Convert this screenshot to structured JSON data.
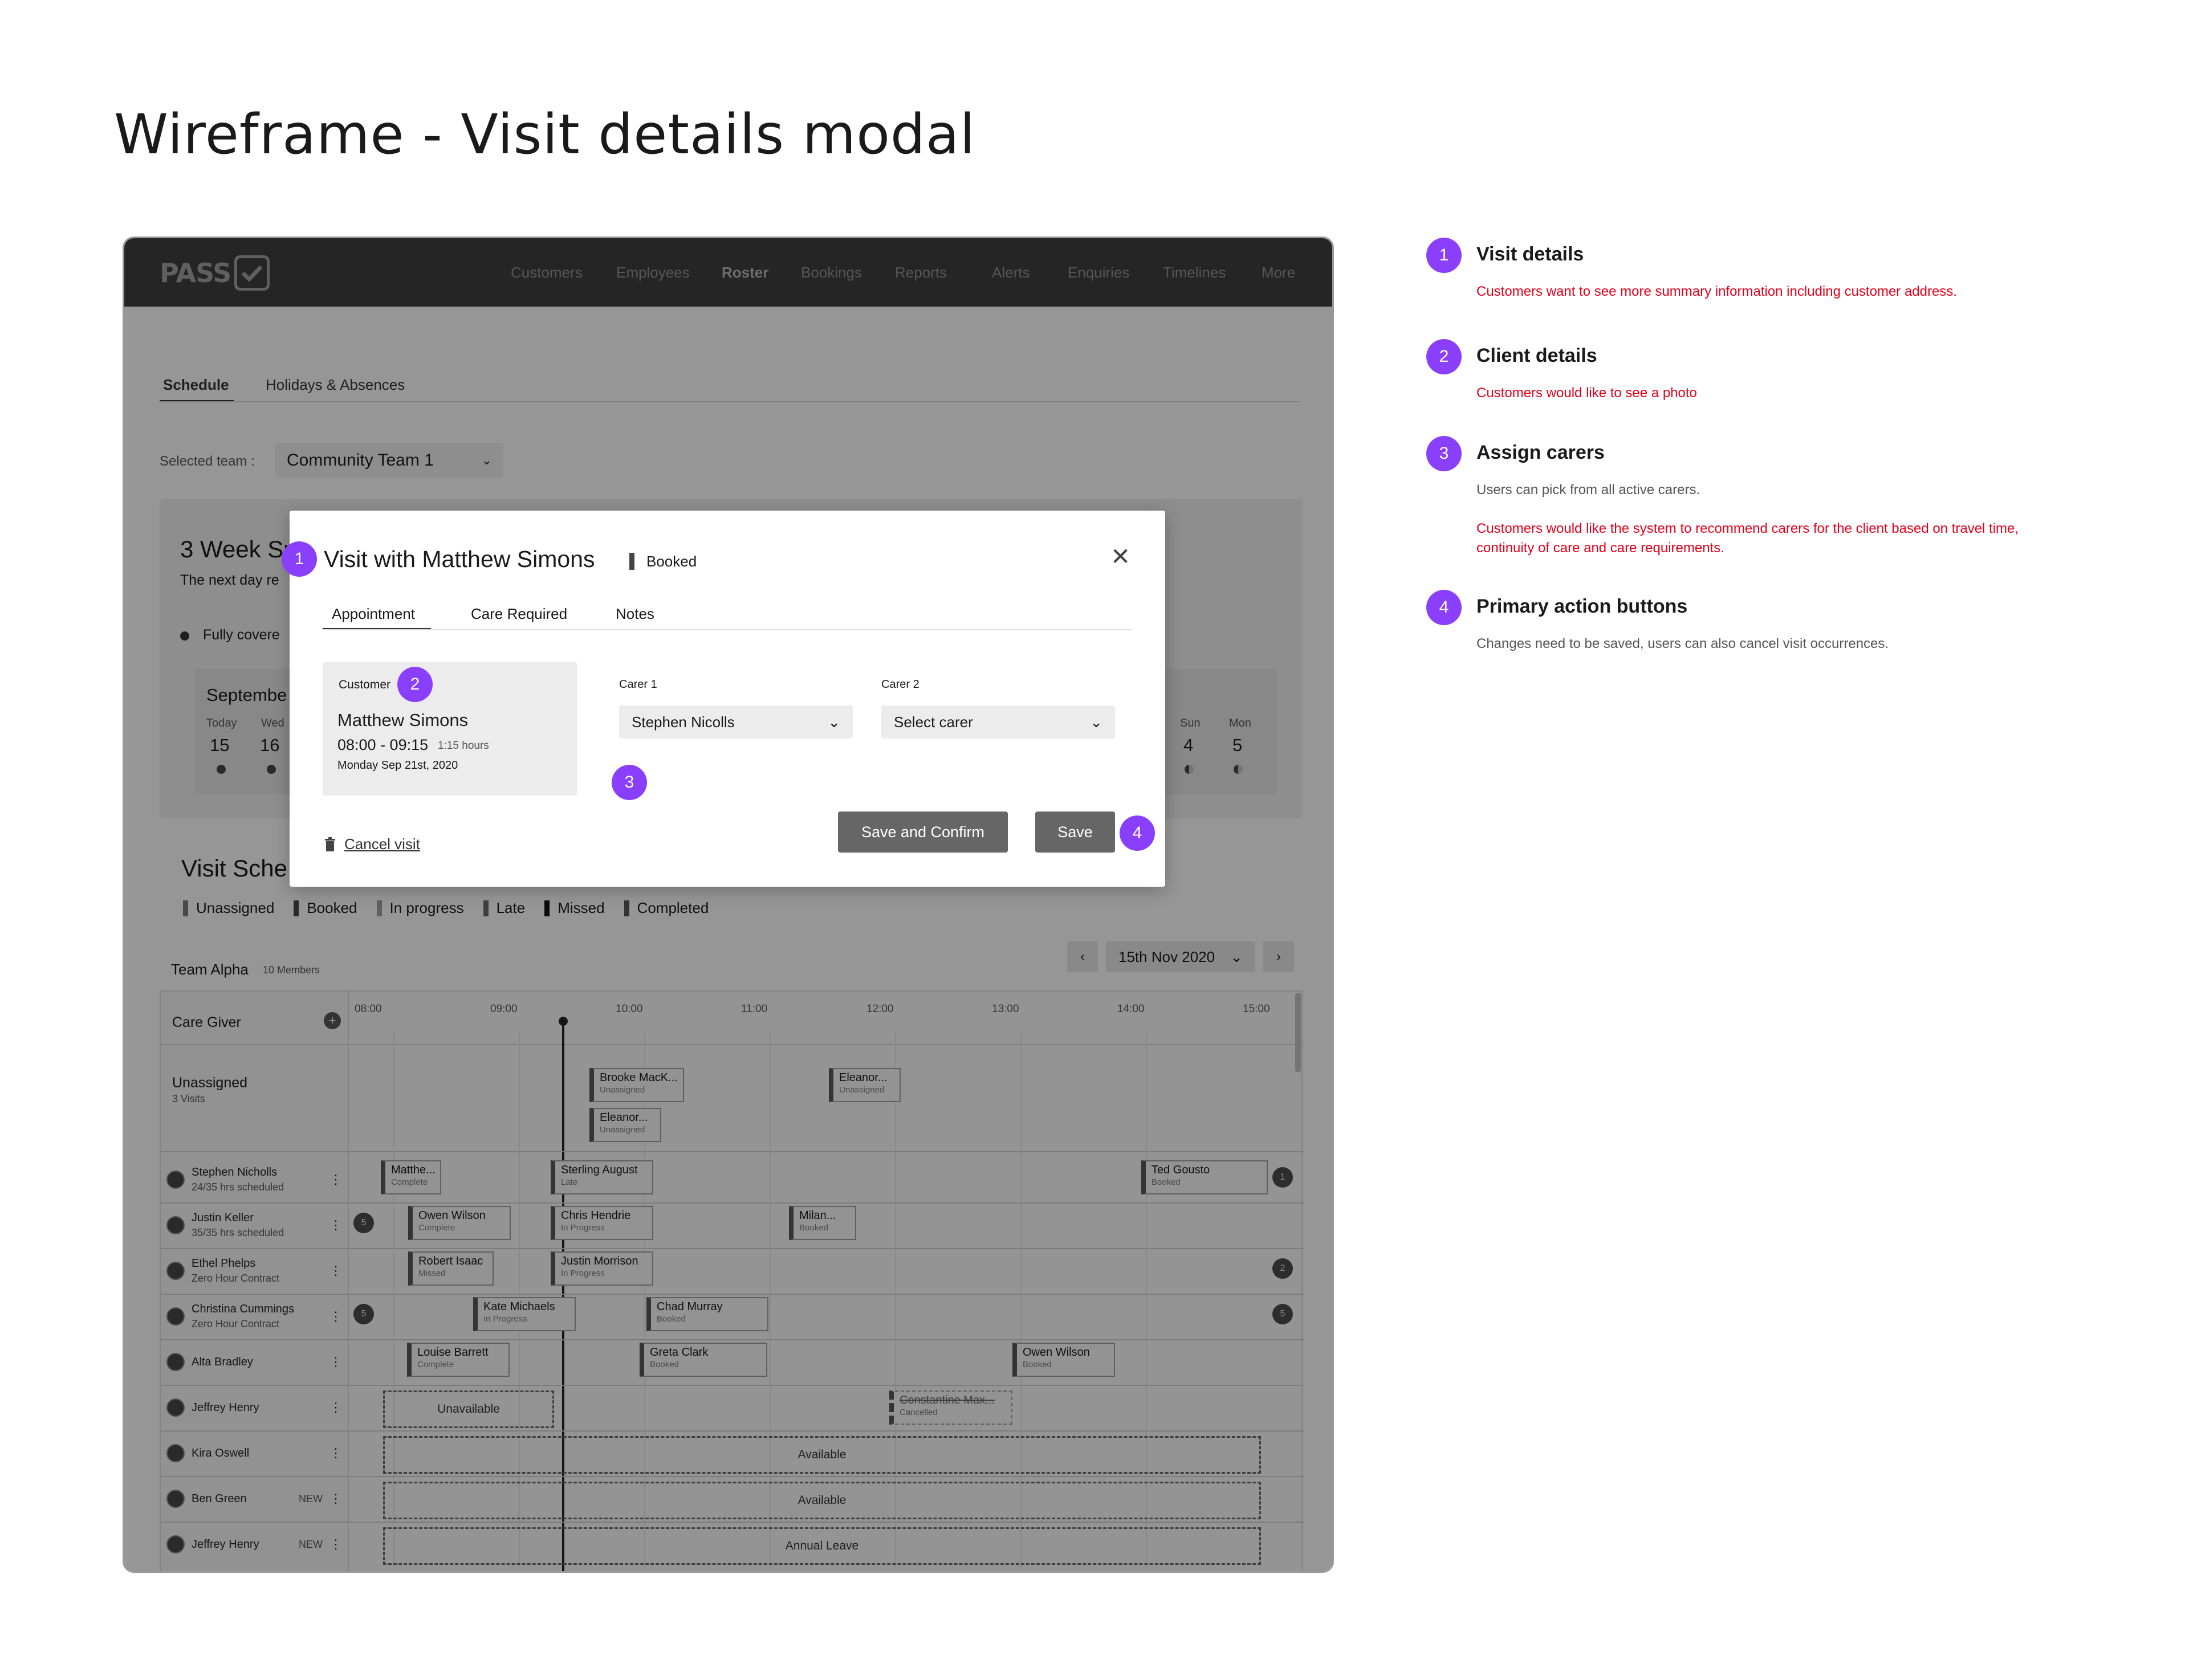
{
  "title": "Wireframe - Visit details modal",
  "app": {
    "logo_text": "PASS",
    "nav": [
      "Customers",
      "Employees",
      "Roster",
      "Bookings",
      "Reports",
      "Alerts",
      "Enquiries",
      "Timelines",
      "More"
    ],
    "nav_active": "Roster",
    "tabs": [
      "Schedule",
      "Holidays & Absences"
    ],
    "selected_team_label": "Selected team :",
    "selected_team_value": "Community Team 1",
    "summary": {
      "title": "3 Week Su",
      "subtitle": "The next day re",
      "fully_covered": "Fully covere",
      "month": "Septembe",
      "days_left": [
        {
          "day": "Today",
          "date": "15"
        },
        {
          "day": "Wed",
          "date": "16"
        }
      ],
      "days_right": [
        {
          "day": "Sun",
          "date": "4"
        },
        {
          "day": "Mon",
          "date": "5"
        }
      ]
    },
    "visit_schedule": {
      "title": "Visit Sche",
      "legend": [
        "Unassigned",
        "Booked",
        "In progress",
        "Late",
        "Missed",
        "Completed"
      ],
      "team_name": "Team Alpha",
      "team_members": "10 Members",
      "date_picker": "15th Nov 2020",
      "care_giver_header": "Care Giver",
      "times": [
        "08:00",
        "09:00",
        "10:00",
        "11:00",
        "12:00",
        "13:00",
        "14:00",
        "15:00"
      ],
      "unassigned": {
        "label": "Unassigned",
        "count": "3 Visits"
      },
      "employees": [
        {
          "name": "Stephen Nicholls",
          "sub": "24/35 hrs scheduled"
        },
        {
          "name": "Justin Keller",
          "sub": "35/35 hrs scheduled"
        },
        {
          "name": "Ethel Phelps",
          "sub": "Zero Hour Contract"
        },
        {
          "name": "Christina Cummings",
          "sub": "Zero Hour Contract"
        },
        {
          "name": "Alta Bradley",
          "sub": ""
        },
        {
          "name": "Jeffrey Henry",
          "sub": ""
        },
        {
          "name": "Kira Oswell",
          "sub": ""
        },
        {
          "name": "Ben Green",
          "sub": "",
          "tag": "NEW"
        },
        {
          "name": "Jeffrey Henry",
          "sub": "",
          "tag": "NEW"
        }
      ],
      "chips": {
        "u1": {
          "name": "Brooke MacK...",
          "status": "Unassigned"
        },
        "u2": {
          "name": "Eleanor...",
          "status": "Unassigned"
        },
        "u3": {
          "name": "Eleanor...",
          "status": "Unassigned"
        },
        "c1": {
          "name": "Matthe...",
          "status": "Complete"
        },
        "c2": {
          "name": "Sterling August",
          "status": "Late"
        },
        "c3": {
          "name": "Ted Gousto",
          "status": "Booked"
        },
        "c4": {
          "name": "Owen Wilson",
          "status": "Complete"
        },
        "c5": {
          "name": "Chris Hendrie",
          "status": "In Progress"
        },
        "c6": {
          "name": "Milan...",
          "status": "Booked"
        },
        "c7": {
          "name": "Robert Isaac",
          "status": "Missed"
        },
        "c8": {
          "name": "Justin Morrison",
          "status": "In Progress"
        },
        "c9": {
          "name": "Kate Michaels",
          "status": "In Progress"
        },
        "c10": {
          "name": "Chad Murray",
          "status": "Booked"
        },
        "c11": {
          "name": "Louise Barrett",
          "status": "Complete"
        },
        "c12": {
          "name": "Greta Clark",
          "status": "Booked"
        },
        "c13": {
          "name": "Owen Wilson",
          "status": "Booked"
        },
        "c14": {
          "name": "Constantine Max...",
          "status": "Cancelled"
        }
      },
      "dashed": {
        "unavailable": "Unavailable",
        "available": "Available",
        "annual_leave": "Annual Leave"
      },
      "badges": {
        "b1": "1",
        "b2": "5",
        "b3": "2",
        "b4": "5",
        "b5": "5"
      }
    }
  },
  "modal": {
    "title": "Visit with Matthew Simons",
    "status": "Booked",
    "tabs": [
      "Appointment",
      "Care Required",
      "Notes"
    ],
    "customer_label": "Customer",
    "customer_name": "Matthew Simons",
    "time": "08:00 - 09:15",
    "duration": "1:15 hours",
    "date": "Monday Sep 21st, 2020",
    "carer1_label": "Carer 1",
    "carer1_value": "Stephen Nicolls",
    "carer2_label": "Carer 2",
    "carer2_value": "Select carer",
    "cancel": "Cancel visit",
    "save_confirm": "Save and Confirm",
    "save": "Save"
  },
  "markers": [
    "1",
    "2",
    "3",
    "4"
  ],
  "notes": [
    {
      "num": "1",
      "title": "Visit details",
      "lines": [
        {
          "text": "Customers want to see more summary information including customer address.",
          "color": "red"
        }
      ]
    },
    {
      "num": "2",
      "title": "Client details",
      "lines": [
        {
          "text": "Customers would like to see a photo",
          "color": "red"
        }
      ]
    },
    {
      "num": "3",
      "title": "Assign carers",
      "lines": [
        {
          "text": "Users can pick from all active carers.",
          "color": "gray"
        },
        {
          "text": "Customers would like the system to recommend carers for the client based on travel time, continuity of care and care requirements.",
          "color": "red"
        }
      ]
    },
    {
      "num": "4",
      "title": "Primary action buttons",
      "lines": [
        {
          "text": "Changes need to be saved, users can also cancel visit occurrences.",
          "color": "gray"
        }
      ]
    }
  ],
  "colors": {
    "accent": "#8a3ffc",
    "annotation_red": "#e5001c",
    "nav_bg": "#3c3c3c"
  }
}
